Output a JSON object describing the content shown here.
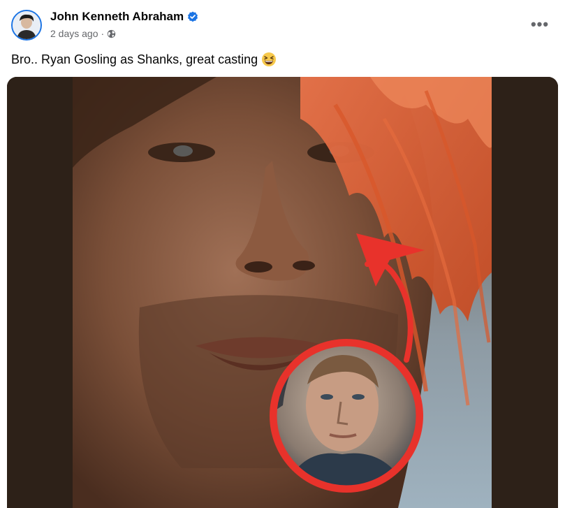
{
  "post": {
    "author": {
      "name": "John Kenneth Abraham",
      "verified_icon": "verified-badge-icon",
      "avatar_icon": "profile-avatar"
    },
    "meta": {
      "time": "2 days ago",
      "separator": "·",
      "audience_icon": "globe-icon"
    },
    "more_icon": "more-options-icon",
    "more_label": "•••",
    "caption": "Bro.. Ryan Gosling as Shanks, great casting",
    "caption_emoji": "grinning-squinting-face-emoji",
    "media": {
      "icon": "post-photo",
      "colors": {
        "background": "#2d2118",
        "hair": "#d8572a",
        "arrow": "#e8322b",
        "circle_ring": "#e8322b"
      }
    }
  },
  "colors": {
    "verified_blue": "#1b74e4",
    "secondary_text": "#65676b"
  }
}
